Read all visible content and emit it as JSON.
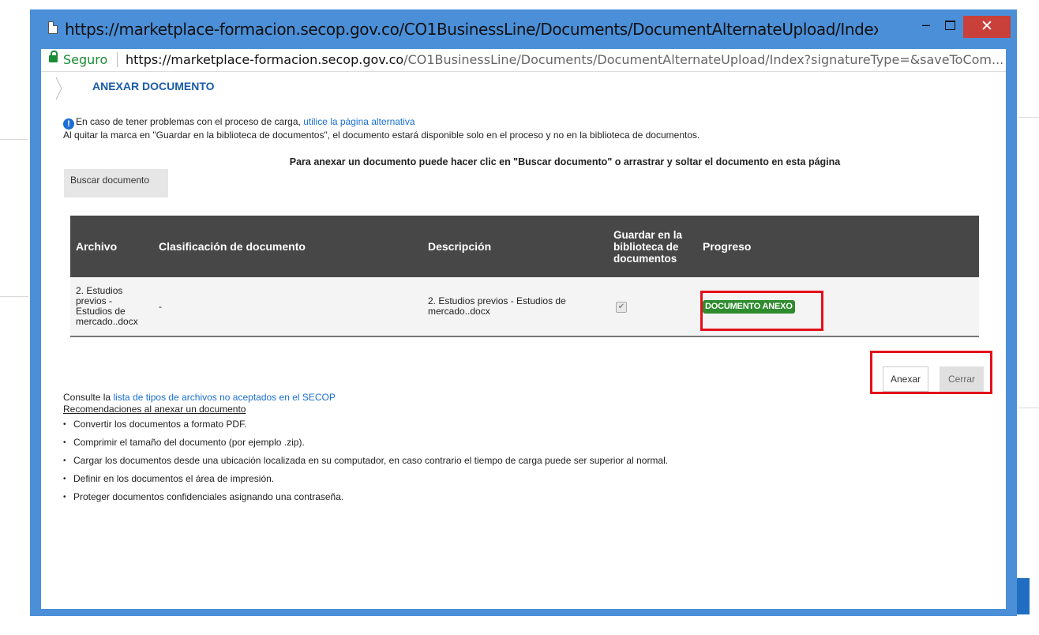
{
  "window": {
    "title": "https://marketplace-formacion.secop.gov.co/CO1BusinessLine/Documents/DocumentAlternateUpload/Index?signatureType=...",
    "controls": {
      "minimize": "–",
      "close": "✕"
    }
  },
  "addressbar": {
    "secure_label": "Seguro",
    "url_host": "https://marketplace-formacion.secop.gov.co",
    "url_path": "/CO1BusinessLine/Documents/DocumentAlternateUpload/Index?signatureType=&saveToCom..."
  },
  "page": {
    "title": "ANEXAR DOCUMENTO",
    "info_text": "En caso de tener problemas con el proceso de carga,",
    "info_link": "utilice la página alternativa",
    "info_note": "Al quitar la marca en \"Guardar en la biblioteca de documentos\", el documento estará disponible solo en el proceso y no en la biblioteca de documentos.",
    "instructions": "Para anexar un documento puede hacer clic en \"Buscar documento\" o arrastrar y soltar el documento en esta página",
    "search_button": "Buscar documento"
  },
  "table": {
    "headers": {
      "archivo": "Archivo",
      "clasificacion": "Clasificación de documento",
      "descripcion": "Descripción",
      "guardar": "Guardar en la biblioteca de documentos",
      "progreso": "Progreso"
    },
    "rows": [
      {
        "archivo": "2. Estudios previos - Estudios de mercado..docx",
        "clasificacion": "-",
        "descripcion": "2. Estudios previos - Estudios de mercado..docx",
        "guardar_checked": true,
        "progreso": "DOCUMENTO ANEXO",
        "progreso_color": "#2e8b2e"
      }
    ]
  },
  "actions": {
    "anexar": "Anexar",
    "cerrar": "Cerrar"
  },
  "help": {
    "prefix": "Consulte la",
    "link": "lista de tipos de archivos no aceptados en el SECOP",
    "reco_title": "Recomendaciones al anexar un documento",
    "items": [
      "Convertir los documentos a formato PDF.",
      "Comprimir el tamaño del documento (por ejemplo .zip).",
      "Cargar los documentos desde una ubicación localizada en su computador, en caso contrario el tiempo de carga puede ser superior al normal.",
      "Definir en los documentos el área de impresión.",
      "Proteger documentos confidenciales asignando una contraseña."
    ]
  },
  "colors": {
    "window_frame": "#4a8fd8",
    "close_button": "#c9403a",
    "secure_green": "#1b8c35",
    "link_blue": "#1a6fd0",
    "title_blue": "#1a5ca8",
    "table_header": "#474747",
    "highlight": "#e3101a"
  }
}
